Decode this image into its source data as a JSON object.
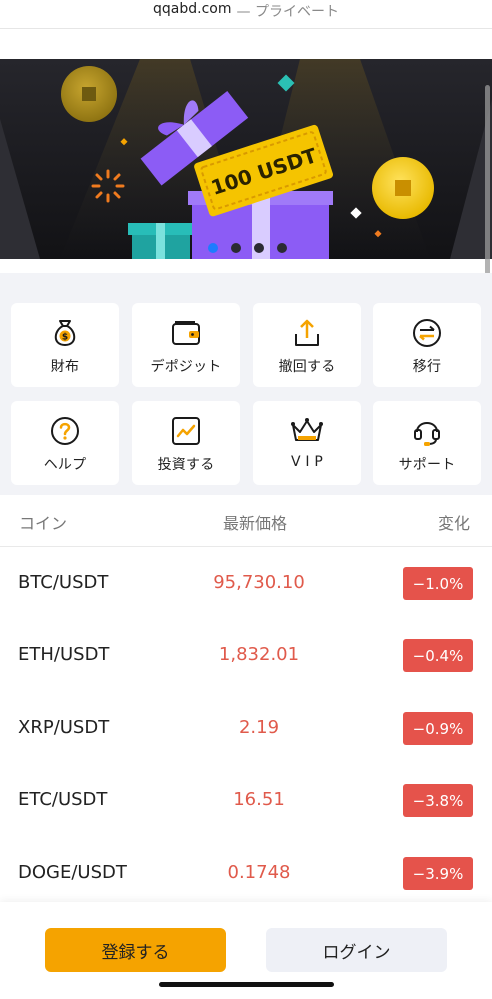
{
  "browser": {
    "url": "qqabd.com",
    "mode": "— プライベート"
  },
  "banner": {
    "ticket_text": "100 USDT",
    "slide_count": 4,
    "active_slide": 1
  },
  "menu": {
    "items": [
      {
        "label": "財布",
        "icon": "wallet-bag-icon"
      },
      {
        "label": "デポジット",
        "icon": "wallet-icon"
      },
      {
        "label": "撤回する",
        "icon": "upload-icon"
      },
      {
        "label": "移行",
        "icon": "transfer-icon"
      },
      {
        "label": "ヘルプ",
        "icon": "help-icon"
      },
      {
        "label": "投資する",
        "icon": "chart-icon"
      },
      {
        "label": "V I P",
        "icon": "crown-icon"
      },
      {
        "label": "サポート",
        "icon": "headset-icon"
      }
    ]
  },
  "table": {
    "headers": {
      "coin": "コイン",
      "price": "最新価格",
      "change": "変化"
    },
    "rows": [
      {
        "pair": "BTC/USDT",
        "price": "95,730.10",
        "change": "−1.0%"
      },
      {
        "pair": "ETH/USDT",
        "price": "1,832.01",
        "change": "−0.4%"
      },
      {
        "pair": "XRP/USDT",
        "price": "2.19",
        "change": "−0.9%"
      },
      {
        "pair": "ETC/USDT",
        "price": "16.51",
        "change": "−3.8%"
      },
      {
        "pair": "DOGE/USDT",
        "price": "0.1748",
        "change": "−3.9%"
      }
    ]
  },
  "actions": {
    "register": "登録する",
    "login": "ログイン"
  },
  "colors": {
    "accent": "#f5a300",
    "negative": "#e5534b",
    "price_text": "#e05a4b",
    "dot_active": "#1d7cff"
  }
}
